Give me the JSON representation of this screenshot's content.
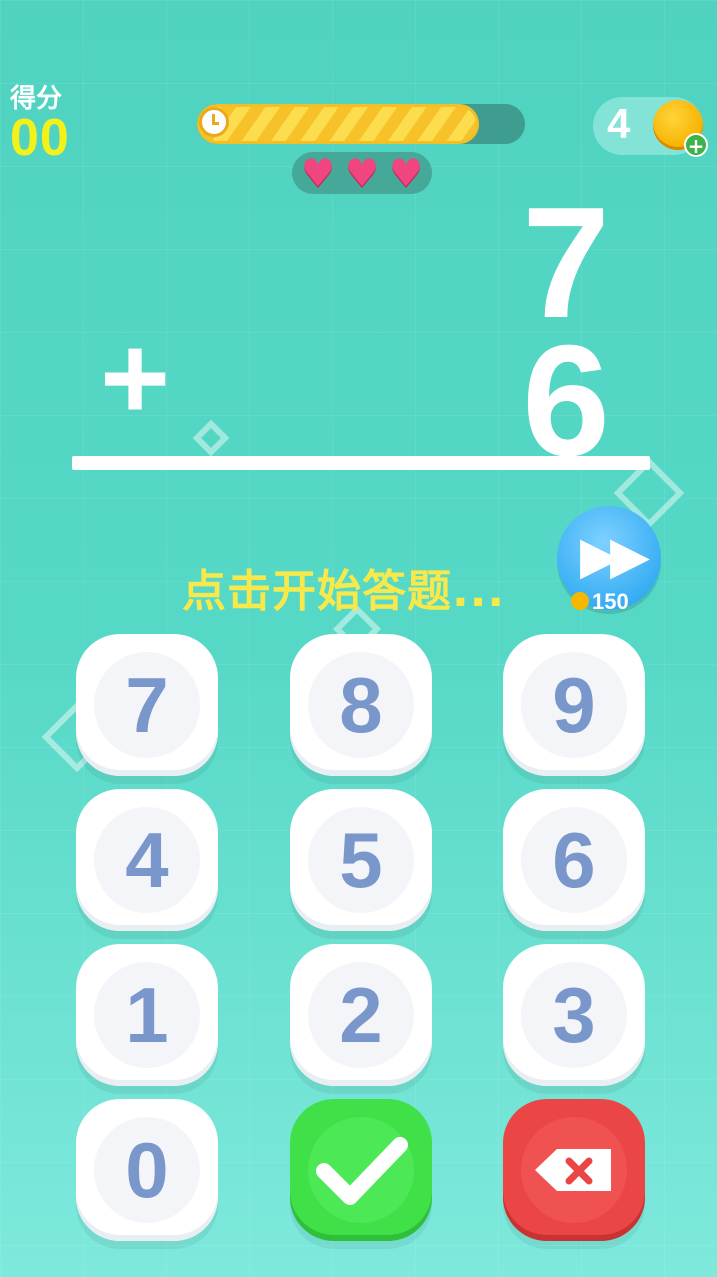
{
  "score": {
    "label": "得分",
    "value": "00"
  },
  "timer": {
    "progress": 0.86
  },
  "lives": {
    "count": 3,
    "icon": "heart-icon"
  },
  "coins": {
    "count": "4",
    "add_icon": "+"
  },
  "problem": {
    "operand1": "7",
    "operator": "+",
    "operand2": "6"
  },
  "prompt": {
    "text": "点击开始答题..."
  },
  "skip": {
    "icon": "fast-forward-icon",
    "cost": "150"
  },
  "keypad": {
    "keys": [
      "7",
      "8",
      "9",
      "4",
      "5",
      "6",
      "1",
      "2",
      "3",
      "0"
    ],
    "confirm_icon": "check-icon",
    "delete_icon": "backspace-icon"
  },
  "colors": {
    "score": "#f2f21a",
    "prompt": "#f7e94c",
    "digit": "#7a97cb",
    "confirm": "#3fe048",
    "delete": "#ea4646"
  }
}
